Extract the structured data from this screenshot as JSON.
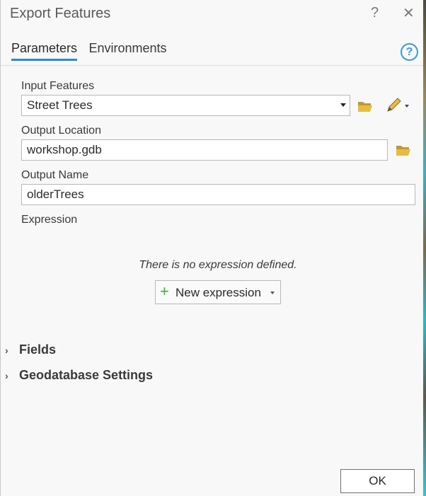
{
  "window": {
    "title": "Export Features",
    "help_glyph": "?",
    "close_glyph": "✕"
  },
  "tabs": [
    {
      "label": "Parameters",
      "active": true
    },
    {
      "label": "Environments",
      "active": false
    }
  ],
  "help_icon_glyph": "?",
  "form": {
    "input_features": {
      "label": "Input Features",
      "value": "Street Trees"
    },
    "output_location": {
      "label": "Output Location",
      "value": "workshop.gdb"
    },
    "output_name": {
      "label": "Output Name",
      "value": "olderTrees"
    },
    "expression": {
      "label": "Expression",
      "empty_message": "There is no expression defined.",
      "new_button_label": "New expression"
    }
  },
  "sections": [
    {
      "label": "Fields"
    },
    {
      "label": "Geodatabase Settings"
    }
  ],
  "footer": {
    "ok_label": "OK"
  },
  "colors": {
    "accent": "#2a8cc8",
    "folder": "#e0b43a",
    "plus": "#4aa84a"
  },
  "icons": [
    "help-icon",
    "close-icon",
    "folder-icon",
    "pencil-icon",
    "plus-icon",
    "chevron-right-icon"
  ]
}
